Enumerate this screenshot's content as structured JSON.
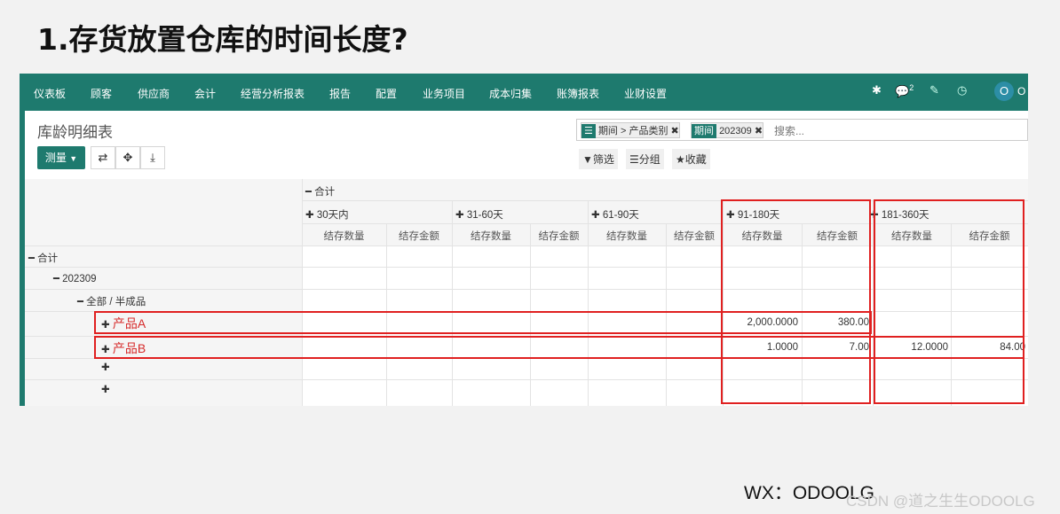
{
  "slide": {
    "title": "1.存货放置仓库的时间长度?"
  },
  "navbar": {
    "items": [
      "仪表板",
      "顾客",
      "供应商",
      "会计",
      "经营分析报表",
      "报告",
      "配置",
      "业务项目",
      "成本归集",
      "账簿报表",
      "业财设置"
    ],
    "message_count": "2",
    "avatar_letter": "O",
    "avatar_tail": "O"
  },
  "page": {
    "breadcrumb": "库龄明细表",
    "measure_label": "测量",
    "facets": [
      {
        "tag": "",
        "text": "期间 > 产品类别"
      },
      {
        "tag": "期间",
        "text": "202309"
      }
    ],
    "search_placeholder": "搜索...",
    "filter_label": "筛选",
    "group_label": "分组",
    "favorite_label": "收藏"
  },
  "pivot": {
    "total_label": "合计",
    "col_groups": [
      "30天内",
      "31-60天",
      "61-90天",
      "91-180天",
      "181-360天"
    ],
    "measure_qty": "结存数量",
    "measure_amt": "结存金额",
    "row_total": "合计",
    "row_period": "202309",
    "row_category": "全部 / 半成品",
    "rows": [
      {
        "label": "产品A",
        "g4_qty": "2,000.0000",
        "g4_amt": "380.00",
        "g5_qty": "",
        "g5_amt": ""
      },
      {
        "label": "产品B",
        "g4_qty": "1.0000",
        "g4_amt": "7.00",
        "g5_qty": "12.0000",
        "g5_amt": "84.00"
      }
    ]
  },
  "footer": {
    "wx": "WX：ODOOLG",
    "watermark": "CSDN @道之生生ODOOLG"
  },
  "colors": {
    "navbar": "#1e7a6e",
    "highlight": "#e02020"
  }
}
